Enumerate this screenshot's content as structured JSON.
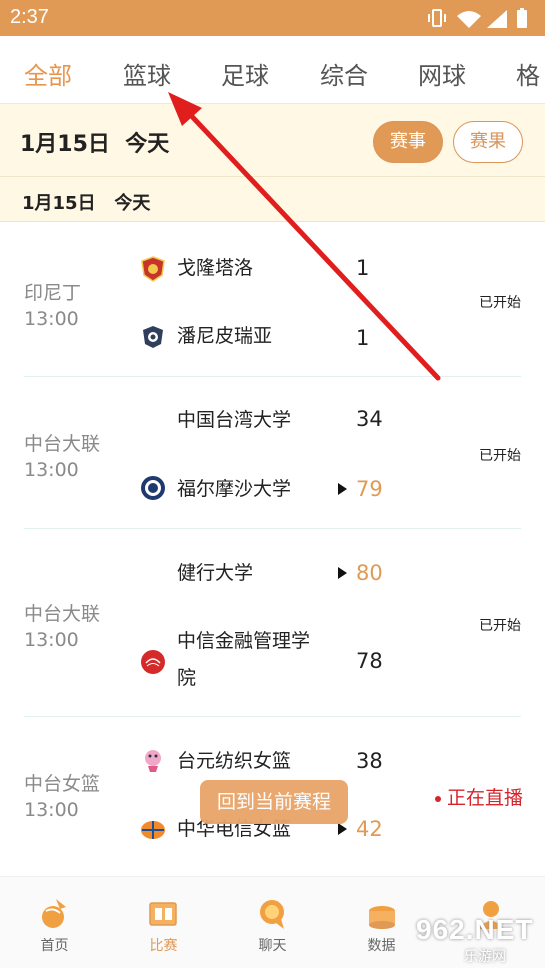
{
  "status_bar": {
    "time": "2:37"
  },
  "tabs": [
    "全部",
    "篮球",
    "足球",
    "综合",
    "网球",
    "格"
  ],
  "date_header": {
    "date": "1月15日",
    "day": "今天",
    "btn_events": "赛事",
    "btn_results": "赛果"
  },
  "sub_header": {
    "date": "1月15日",
    "day": "今天"
  },
  "matches": [
    {
      "league": "印尼丁",
      "time": "13:00",
      "home": "戈隆塔洛",
      "away": "潘尼皮瑞亚",
      "home_score": "1",
      "away_score": "1",
      "status": "已开始"
    },
    {
      "league": "中台大联",
      "time": "13:00",
      "home": "中国台湾大学",
      "away": "福尔摩沙大学",
      "home_score": "34",
      "away_score": "79",
      "status": "已开始"
    },
    {
      "league": "中台大联",
      "time": "13:00",
      "home": "健行大学",
      "away_line1": "中信金融管理学",
      "away_line2": "院",
      "home_score": "80",
      "away_score": "78",
      "status": "已开始"
    },
    {
      "league": "中台女篮",
      "time": "13:00",
      "home": "台元纺织女篮",
      "away": "中华电信女篮",
      "home_score": "38",
      "away_score": "42",
      "status": "正在直播"
    }
  ],
  "back_button": "回到当前赛程",
  "bottom_nav": [
    "首页",
    "比赛",
    "聊天",
    "数据",
    ""
  ],
  "watermark": {
    "logo": "962.NET",
    "site": "乐游网"
  },
  "colors": {
    "accent": "#E09A55",
    "live": "#D6242B",
    "arrow": "#E01E1E"
  }
}
